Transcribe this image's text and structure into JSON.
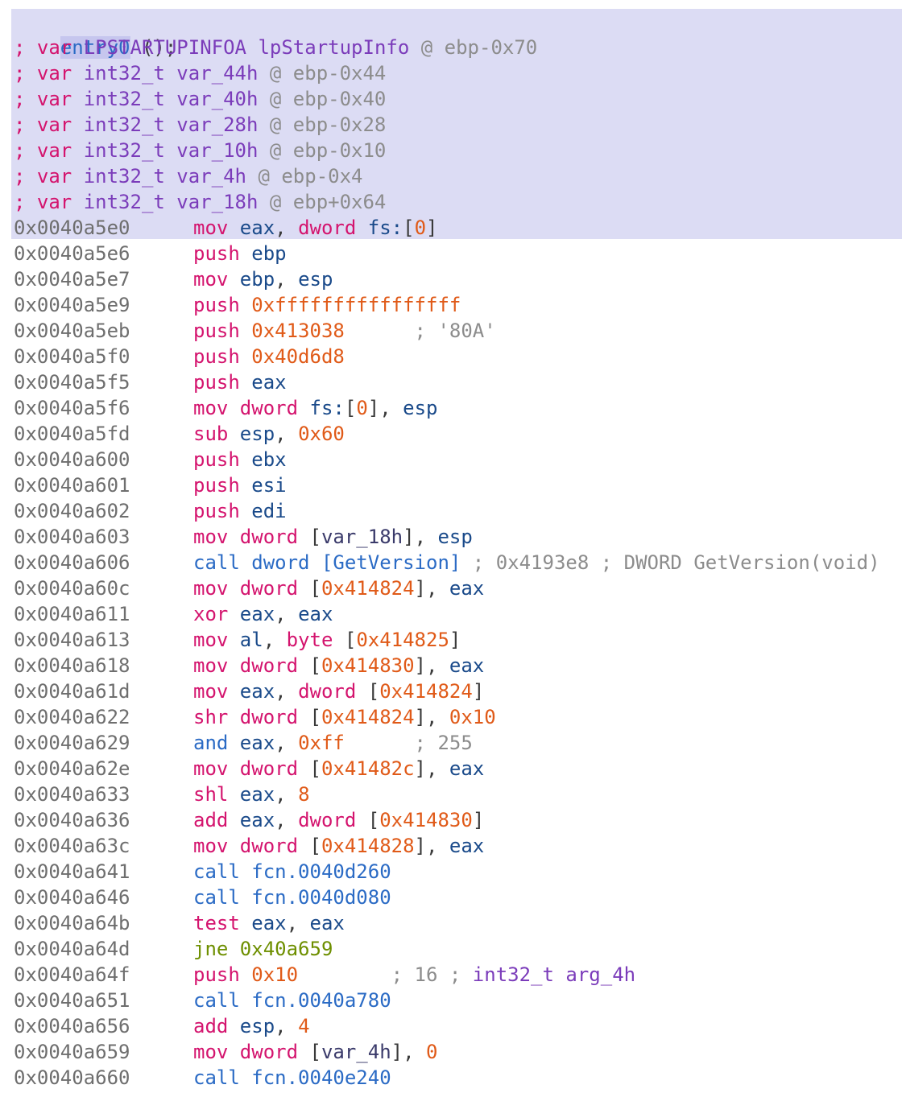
{
  "header": {
    "entry_label": "entry0",
    "entry_suffix": " ();",
    "vars": [
      {
        "type": "LPSTARTUPINFOA",
        "name": "lpStartupInfo",
        "loc": "@ ebp-0x70"
      },
      {
        "type": "int32_t",
        "name": "var_44h",
        "loc": "@ ebp-0x44"
      },
      {
        "type": "int32_t",
        "name": "var_40h",
        "loc": "@ ebp-0x40"
      },
      {
        "type": "int32_t",
        "name": "var_28h",
        "loc": "@ ebp-0x28"
      },
      {
        "type": "int32_t",
        "name": "var_10h",
        "loc": "@ ebp-0x10"
      },
      {
        "type": "int32_t",
        "name": "var_4h",
        "loc": "@ ebp-0x4"
      },
      {
        "type": "int32_t",
        "name": "var_18h",
        "loc": "@ ebp+0x64"
      }
    ],
    "var_prefix": "; var ",
    "highlight_color": "#dcdcf4"
  },
  "instructions": [
    {
      "addr": "0x0040a5e0",
      "op": "mov",
      "args": [
        [
          "eax",
          "reg"
        ],
        [
          ", ",
          "p"
        ],
        [
          "dword ",
          "kw"
        ],
        [
          "fs:",
          "reg"
        ],
        [
          "[",
          "p"
        ],
        [
          "0",
          "num"
        ],
        [
          "]",
          "p"
        ]
      ]
    },
    {
      "addr": "0x0040a5e6",
      "op": "push",
      "args": [
        [
          "ebp",
          "reg"
        ]
      ]
    },
    {
      "addr": "0x0040a5e7",
      "op": "mov",
      "args": [
        [
          "ebp",
          "reg"
        ],
        [
          ", ",
          "p"
        ],
        [
          "esp",
          "reg"
        ]
      ]
    },
    {
      "addr": "0x0040a5e9",
      "op": "push",
      "args": [
        [
          "0xffffffffffffffff",
          "num"
        ]
      ]
    },
    {
      "addr": "0x0040a5eb",
      "op": "push",
      "args": [
        [
          "0x413038",
          "num"
        ],
        [
          "      ; '80A'",
          "cmt"
        ]
      ]
    },
    {
      "addr": "0x0040a5f0",
      "op": "push",
      "args": [
        [
          "0x40d6d8",
          "num"
        ]
      ]
    },
    {
      "addr": "0x0040a5f5",
      "op": "push",
      "args": [
        [
          "eax",
          "reg"
        ]
      ]
    },
    {
      "addr": "0x0040a5f6",
      "op": "mov",
      "args": [
        [
          "dword ",
          "kw"
        ],
        [
          "fs:",
          "reg"
        ],
        [
          "[",
          "p"
        ],
        [
          "0",
          "num"
        ],
        [
          "]",
          "p"
        ],
        [
          ", ",
          "p"
        ],
        [
          "esp",
          "reg"
        ]
      ]
    },
    {
      "addr": "0x0040a5fd",
      "op": "sub",
      "args": [
        [
          "esp",
          "reg"
        ],
        [
          ", ",
          "p"
        ],
        [
          "0x60",
          "num"
        ]
      ]
    },
    {
      "addr": "0x0040a600",
      "op": "push",
      "args": [
        [
          "ebx",
          "reg"
        ]
      ]
    },
    {
      "addr": "0x0040a601",
      "op": "push",
      "args": [
        [
          "esi",
          "reg"
        ]
      ]
    },
    {
      "addr": "0x0040a602",
      "op": "push",
      "args": [
        [
          "edi",
          "reg"
        ]
      ]
    },
    {
      "addr": "0x0040a603",
      "op": "mov",
      "args": [
        [
          "dword ",
          "kw"
        ],
        [
          "[",
          "p"
        ],
        [
          "var_18h",
          "var"
        ],
        [
          "]",
          "p"
        ],
        [
          ", ",
          "p"
        ],
        [
          "esp",
          "reg"
        ]
      ]
    },
    {
      "addr": "0x0040a606",
      "op": "call",
      "optype": "call",
      "args": [
        [
          "dword ",
          "call"
        ],
        [
          "[GetVersion]",
          "call"
        ],
        [
          " ; 0x4193e8 ; DWORD GetVersion(void)",
          "cmt"
        ]
      ]
    },
    {
      "addr": "0x0040a60c",
      "op": "mov",
      "args": [
        [
          "dword ",
          "kw"
        ],
        [
          "[",
          "p"
        ],
        [
          "0x414824",
          "num"
        ],
        [
          "]",
          "p"
        ],
        [
          ", ",
          "p"
        ],
        [
          "eax",
          "reg"
        ]
      ]
    },
    {
      "addr": "0x0040a611",
      "op": "xor",
      "args": [
        [
          "eax",
          "reg"
        ],
        [
          ", ",
          "p"
        ],
        [
          "eax",
          "reg"
        ]
      ]
    },
    {
      "addr": "0x0040a613",
      "op": "mov",
      "args": [
        [
          "al",
          "reg"
        ],
        [
          ", ",
          "p"
        ],
        [
          "byte ",
          "kw"
        ],
        [
          "[",
          "p"
        ],
        [
          "0x414825",
          "num"
        ],
        [
          "]",
          "p"
        ]
      ]
    },
    {
      "addr": "0x0040a618",
      "op": "mov",
      "args": [
        [
          "dword ",
          "kw"
        ],
        [
          "[",
          "p"
        ],
        [
          "0x414830",
          "num"
        ],
        [
          "]",
          "p"
        ],
        [
          ", ",
          "p"
        ],
        [
          "eax",
          "reg"
        ]
      ]
    },
    {
      "addr": "0x0040a61d",
      "op": "mov",
      "args": [
        [
          "eax",
          "reg"
        ],
        [
          ", ",
          "p"
        ],
        [
          "dword ",
          "kw"
        ],
        [
          "[",
          "p"
        ],
        [
          "0x414824",
          "num"
        ],
        [
          "]",
          "p"
        ]
      ]
    },
    {
      "addr": "0x0040a622",
      "op": "shr",
      "args": [
        [
          "dword ",
          "kw"
        ],
        [
          "[",
          "p"
        ],
        [
          "0x414824",
          "num"
        ],
        [
          "]",
          "p"
        ],
        [
          ", ",
          "p"
        ],
        [
          "0x10",
          "num"
        ]
      ]
    },
    {
      "addr": "0x0040a629",
      "op": "and",
      "optype": "call",
      "args": [
        [
          "eax",
          "reg"
        ],
        [
          ", ",
          "p"
        ],
        [
          "0xff",
          "num"
        ],
        [
          "      ; 255",
          "cmt"
        ]
      ]
    },
    {
      "addr": "0x0040a62e",
      "op": "mov",
      "args": [
        [
          "dword ",
          "kw"
        ],
        [
          "[",
          "p"
        ],
        [
          "0x41482c",
          "num"
        ],
        [
          "]",
          "p"
        ],
        [
          ", ",
          "p"
        ],
        [
          "eax",
          "reg"
        ]
      ]
    },
    {
      "addr": "0x0040a633",
      "op": "shl",
      "args": [
        [
          "eax",
          "reg"
        ],
        [
          ", ",
          "p"
        ],
        [
          "8",
          "num"
        ]
      ]
    },
    {
      "addr": "0x0040a636",
      "op": "add",
      "args": [
        [
          "eax",
          "reg"
        ],
        [
          ", ",
          "p"
        ],
        [
          "dword ",
          "kw"
        ],
        [
          "[",
          "p"
        ],
        [
          "0x414830",
          "num"
        ],
        [
          "]",
          "p"
        ]
      ]
    },
    {
      "addr": "0x0040a63c",
      "op": "mov",
      "args": [
        [
          "dword ",
          "kw"
        ],
        [
          "[",
          "p"
        ],
        [
          "0x414828",
          "num"
        ],
        [
          "]",
          "p"
        ],
        [
          ", ",
          "p"
        ],
        [
          "eax",
          "reg"
        ]
      ]
    },
    {
      "addr": "0x0040a641",
      "op": "call",
      "optype": "call",
      "args": [
        [
          "fcn.0040d260",
          "call"
        ]
      ]
    },
    {
      "addr": "0x0040a646",
      "op": "call",
      "optype": "call",
      "args": [
        [
          "fcn.0040d080",
          "call"
        ]
      ]
    },
    {
      "addr": "0x0040a64b",
      "op": "test",
      "args": [
        [
          "eax",
          "reg"
        ],
        [
          ", ",
          "p"
        ],
        [
          "eax",
          "reg"
        ]
      ]
    },
    {
      "addr": "0x0040a64d",
      "op": "jne",
      "optype": "jmp",
      "args": [
        [
          "0x40a659",
          "jmp"
        ]
      ]
    },
    {
      "addr": "0x0040a64f",
      "op": "push",
      "args": [
        [
          "0x10",
          "num"
        ],
        [
          "        ; 16 ; ",
          "cmt"
        ],
        [
          "int32_t arg_4h",
          "type"
        ]
      ]
    },
    {
      "addr": "0x0040a651",
      "op": "call",
      "optype": "call",
      "args": [
        [
          "fcn.0040a780",
          "call"
        ]
      ]
    },
    {
      "addr": "0x0040a656",
      "op": "add",
      "args": [
        [
          "esp",
          "reg"
        ],
        [
          ", ",
          "p"
        ],
        [
          "4",
          "num"
        ]
      ]
    },
    {
      "addr": "0x0040a659",
      "op": "mov",
      "args": [
        [
          "dword ",
          "kw"
        ],
        [
          "[",
          "p"
        ],
        [
          "var_4h",
          "var"
        ],
        [
          "]",
          "p"
        ],
        [
          ", ",
          "p"
        ],
        [
          "0",
          "num"
        ]
      ]
    },
    {
      "addr": "0x0040a660",
      "op": "call",
      "optype": "call",
      "args": [
        [
          "fcn.0040e240",
          "call"
        ]
      ]
    }
  ]
}
